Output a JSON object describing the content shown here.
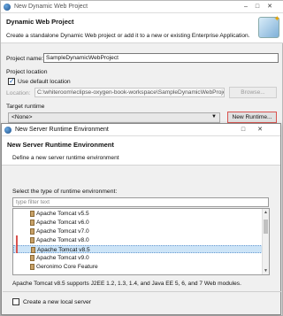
{
  "window": {
    "title": "New Dynamic Web Project",
    "heading": "Dynamic Web Project",
    "description": "Create a standalone Dynamic Web project or add it to a new or existing Enterprise Application."
  },
  "form": {
    "project_name_label": "Project name:",
    "project_name_value": "SampleDynamicWebProject",
    "project_location_label": "Project location",
    "use_default_location_label": "Use default location",
    "use_default_location_checked": true,
    "location_label": "Location:",
    "location_value": "C:\\whiteroom\\eclipse-oxygen-book-workspace\\SampleDynamicWebProje",
    "browse_label": "Browse...",
    "target_runtime_label": "Target runtime",
    "target_runtime_value": "<None>",
    "new_runtime_label": "New Runtime..."
  },
  "dialog": {
    "title": "New Server Runtime Environment",
    "heading": "New Server Runtime Environment",
    "description": "Define a new server runtime environment",
    "select_label": "Select the type of runtime environment:",
    "filter_placeholder": "type filter text",
    "runtimes": [
      "Apache Tomcat v5.5",
      "Apache Tomcat v6.0",
      "Apache Tomcat v7.0",
      "Apache Tomcat v8.0",
      "Apache Tomcat v8.5",
      "Apache Tomcat v9.0",
      "Geronimo Core Feature"
    ],
    "selected_runtime": "Apache Tomcat v8.5",
    "runtime_description": "Apache Tomcat v8.5 supports J2EE 1.2, 1.3, 1.4, and Java EE 5, 6, and 7 Web modules.",
    "create_server_label": "Create a new local server",
    "create_server_checked": false
  },
  "colors": {
    "selection": "#cce4f7",
    "highlight": "#d9534f",
    "accent": "#1a5fb4"
  }
}
